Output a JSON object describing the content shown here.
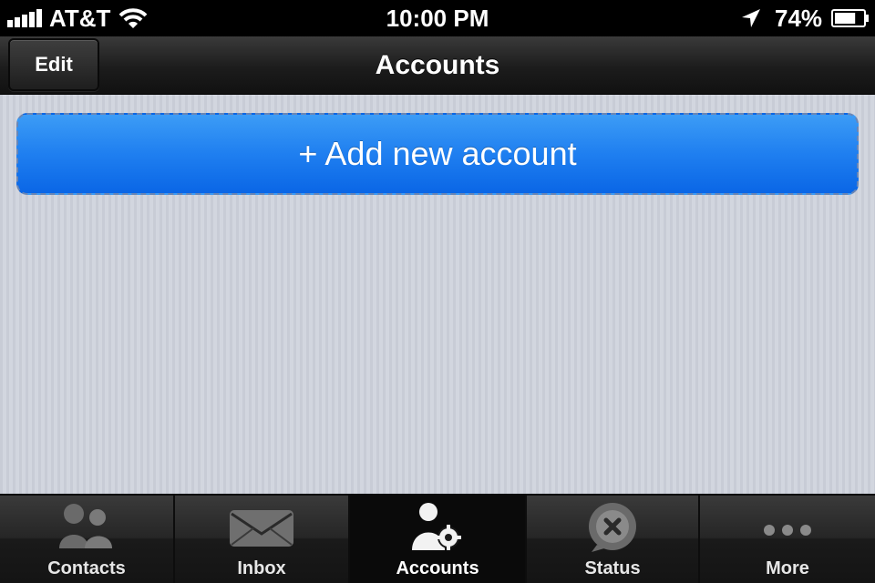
{
  "status_bar": {
    "carrier": "AT&T",
    "time": "10:00 PM",
    "battery_percent": "74%",
    "battery_level": 0.74
  },
  "nav_bar": {
    "edit_label": "Edit",
    "title": "Accounts"
  },
  "content": {
    "add_account_label": "+ Add new account"
  },
  "tab_bar": {
    "tabs": [
      {
        "label": "Contacts",
        "icon": "contacts-icon"
      },
      {
        "label": "Inbox",
        "icon": "inbox-icon"
      },
      {
        "label": "Accounts",
        "icon": "accounts-icon",
        "selected": true
      },
      {
        "label": "Status",
        "icon": "status-icon"
      },
      {
        "label": "More",
        "icon": "more-icon"
      }
    ]
  },
  "colors": {
    "accent_blue": "#1f7ff0",
    "nav_dark": "#1c1c1c",
    "background": "#cfd3dc"
  }
}
